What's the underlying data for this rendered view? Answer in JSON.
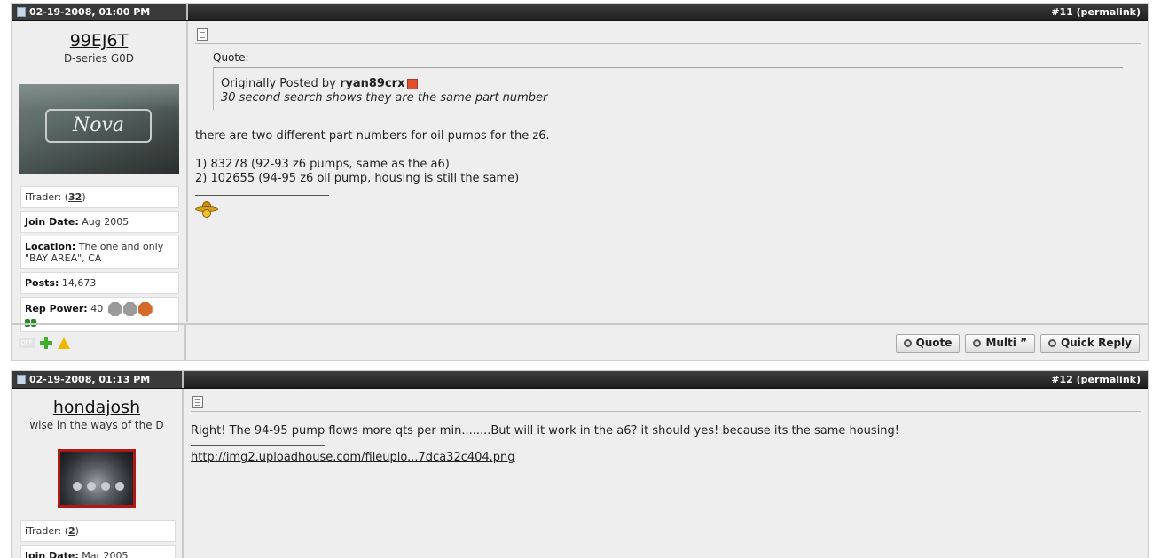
{
  "posts": [
    {
      "date": "02-19-2008, 01:00 PM",
      "post_no": "#11 (permalink)",
      "username": "99EJ6T",
      "user_title": "D-series G0D",
      "stats": {
        "itrader_label": "iTrader: (",
        "itrader_value": "32",
        "itrader_close": ")",
        "join_label": "Join Date:",
        "join_value": " Aug 2005",
        "location_label": "Location:",
        "location_value": " The one and only \"BAY AREA\", CA",
        "posts_label": "Posts:",
        "posts_value": " 14,673",
        "rep_label": "Rep Power:",
        "rep_value": " 40"
      },
      "rep_colors": [
        "#9a9a9a",
        "#9a9a9a",
        "#d36a2a"
      ],
      "quote": {
        "label": "Quote:",
        "prefix": "Originally Posted by ",
        "author": "ryan89crx",
        "text": "30 second search shows they are the same part number"
      },
      "message": {
        "line1": "there are two different part numbers for oil pumps for the z6.",
        "line2": "1) 83278 (92-93 z6 pumps, same as the a6)",
        "line3": "2) 102655 (94-95 z6 oil pump, housing is still the same)"
      },
      "signature_icon": "sombrero-smiley-icon",
      "footer": {
        "status_icon": "offline-icon",
        "rep_icon": "add-reputation-icon",
        "report_icon": "report-warning-icon",
        "off_label": "OFF",
        "quote_btn": "Quote",
        "multi_btn": "Multi ”",
        "quick_btn": "Quick Reply"
      }
    },
    {
      "date": "02-19-2008, 01:13 PM",
      "post_no": "#12 (permalink)",
      "username": "hondajosh",
      "user_title": "wise in the ways of the D",
      "stats": {
        "itrader_label": "iTrader: (",
        "itrader_value": "2",
        "itrader_close": ")",
        "join_label": "Join Date:",
        "join_value": " Mar 2005"
      },
      "message": {
        "line1": "Right! The 94-95 pump flows more qts per min........But will it work in the a6? it should yes! because its the same housing!",
        "link": "http://img2.uploadhouse.com/fileuplo...7dca32c404.png"
      }
    }
  ]
}
